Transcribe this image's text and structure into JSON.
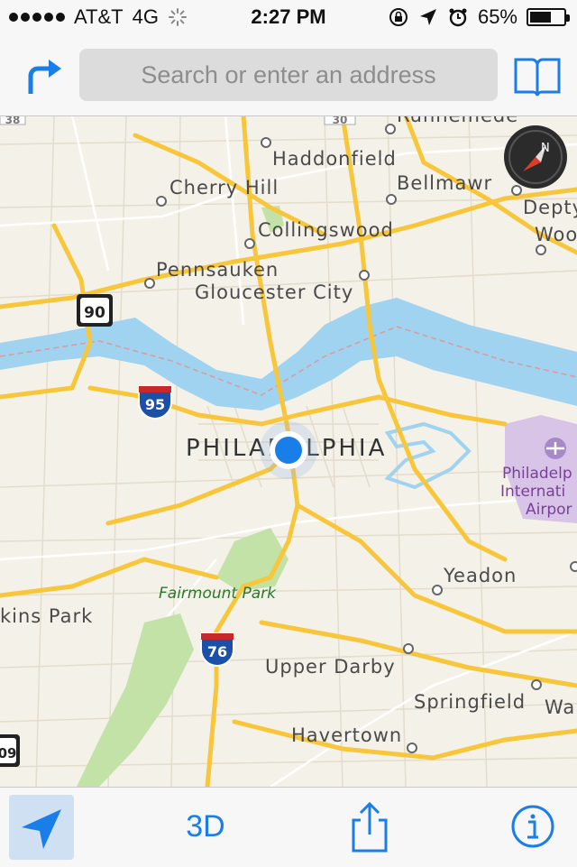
{
  "status_bar": {
    "carrier": "AT&T",
    "network": "4G",
    "time": "2:27 PM",
    "battery": "65%",
    "battery_level": 0.65,
    "icons": [
      "signal-dots",
      "activity-spinner",
      "rotation-lock-icon",
      "location-arrow-icon",
      "alarm-clock-icon",
      "battery-icon"
    ]
  },
  "top_bar": {
    "directions_icon": "turn-arrow-icon",
    "search_placeholder": "Search or enter an address",
    "bookmarks_icon": "book-icon"
  },
  "map": {
    "city_label": "PHILADELPHIA",
    "places": [
      "Runnemede",
      "Haddonfield",
      "Cherry Hill",
      "Bellmawr",
      "Collingswood",
      "Pennsauken",
      "Gloucester City",
      "Yeadon",
      "Upper Darby",
      "Springfield",
      "Havertown"
    ],
    "edge_places": [
      "Depty",
      "Woo",
      "kins Park",
      "Wa"
    ],
    "park": "Fairmount Park",
    "airport": [
      "Philadelp",
      "Internati",
      "Airpor"
    ],
    "highway_shields": [
      {
        "type": "interstate",
        "number": "95"
      },
      {
        "type": "interstate",
        "number": "76"
      },
      {
        "type": "us-route",
        "number": "90"
      },
      {
        "type": "state-route",
        "number": "30"
      },
      {
        "type": "us-route",
        "number": "38"
      },
      {
        "type": "us-route",
        "number": "09"
      }
    ],
    "colors": {
      "land": "#f4f1e8",
      "water": "#9fd3f0",
      "highway": "#f8c63a",
      "park": "#c3e2a8",
      "airport": "#d7c4e6",
      "user_location": "#1a7ee8"
    }
  },
  "bottom_bar": {
    "tracking_icon": "location-arrow-icon",
    "three_d_label": "3D",
    "share_icon": "share-icon",
    "info_icon": "info-icon"
  }
}
